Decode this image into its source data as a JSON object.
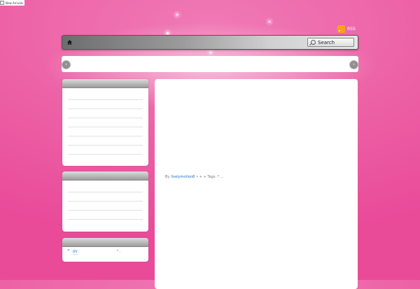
{
  "alt_image": {
    "text": "New Arrivals"
  },
  "header": {
    "rss_label": "RSS"
  },
  "navbar": {
    "search_label": "Search"
  },
  "slider": {
    "prev_symbol": "‹",
    "next_symbol": "›"
  },
  "sidebar": {
    "widget3": {
      "quote": "“",
      "link": "UV",
      "trail": "” ."
    }
  },
  "post": {
    "by": "By",
    "author": "livelymotion8",
    "meta": "• + + Tags: * ..."
  },
  "colors": {
    "background": "#ec5da4",
    "link": "#1a6fcb",
    "rss": "#f7a21b"
  },
  "icons": {
    "home": "home-icon",
    "search": "search-icon",
    "rss": "rss-icon"
  }
}
